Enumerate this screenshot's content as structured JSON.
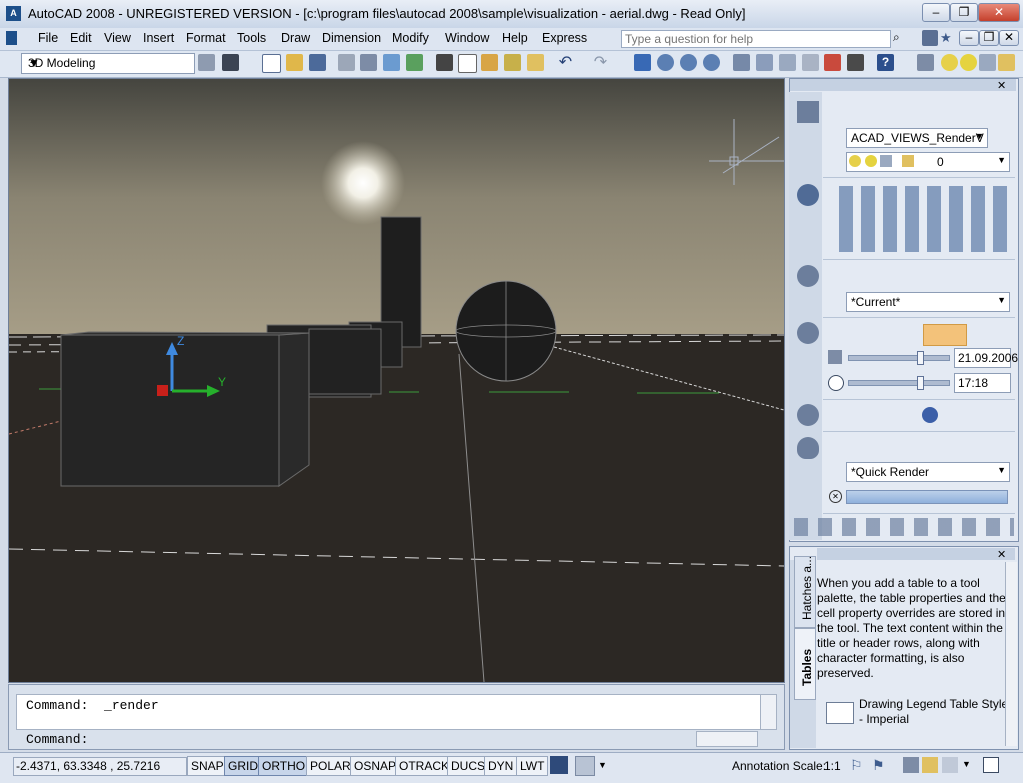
{
  "window": {
    "title": "AutoCAD 2008 - UNREGISTERED VERSION - [c:\\program files\\autocad 2008\\sample\\visualization - aerial.dwg - Read Only]",
    "app_icon": "A",
    "minimize": "‒",
    "restore": "❐",
    "close": "✕"
  },
  "menu": {
    "items": [
      "File",
      "Edit",
      "View",
      "Insert",
      "Format",
      "Tools",
      "Draw",
      "Dimension",
      "Modify",
      "Window",
      "Help",
      "Express"
    ],
    "help_placeholder": "Type a question for help"
  },
  "toolbar": {
    "workspace": "3D Modeling"
  },
  "viewport": {
    "ucs_z": "Z",
    "ucs_y": "Y",
    "sky_top": "#45453f",
    "sky_horizon": "#a89f88",
    "ground": "#2c2824"
  },
  "command": {
    "line1": "Command:  _render",
    "line2": "Command:"
  },
  "status": {
    "coords": "-2.4371,  63.3348  , 25.7216",
    "toggles": [
      "SNAP",
      "GRID",
      "ORTHO",
      "POLAR",
      "OSNAP",
      "OTRACK",
      "DUCS",
      "DYN",
      "LWT"
    ],
    "active_toggles": [
      "GRID",
      "ORTHO"
    ],
    "annotation_label": "Annotation Scale:",
    "annotation_value": "1:1"
  },
  "dashboard": {
    "layer_view": "ACAD_VIEWS_RenderV",
    "layer_current": "0",
    "visual_style": "*Current*",
    "date": "21.09.2006",
    "time": "17:18",
    "render_preset": "*Quick Render"
  },
  "tool_palette": {
    "tabs": [
      "Hatches a...",
      "Tables"
    ],
    "description": "When you add a table to a tool palette, the table properties and the cell property overrides are stored in the tool. The text content within the title or header rows, along with character formatting, is also preserved.",
    "item_label": "Drawing Legend Table Style - Imperial"
  }
}
